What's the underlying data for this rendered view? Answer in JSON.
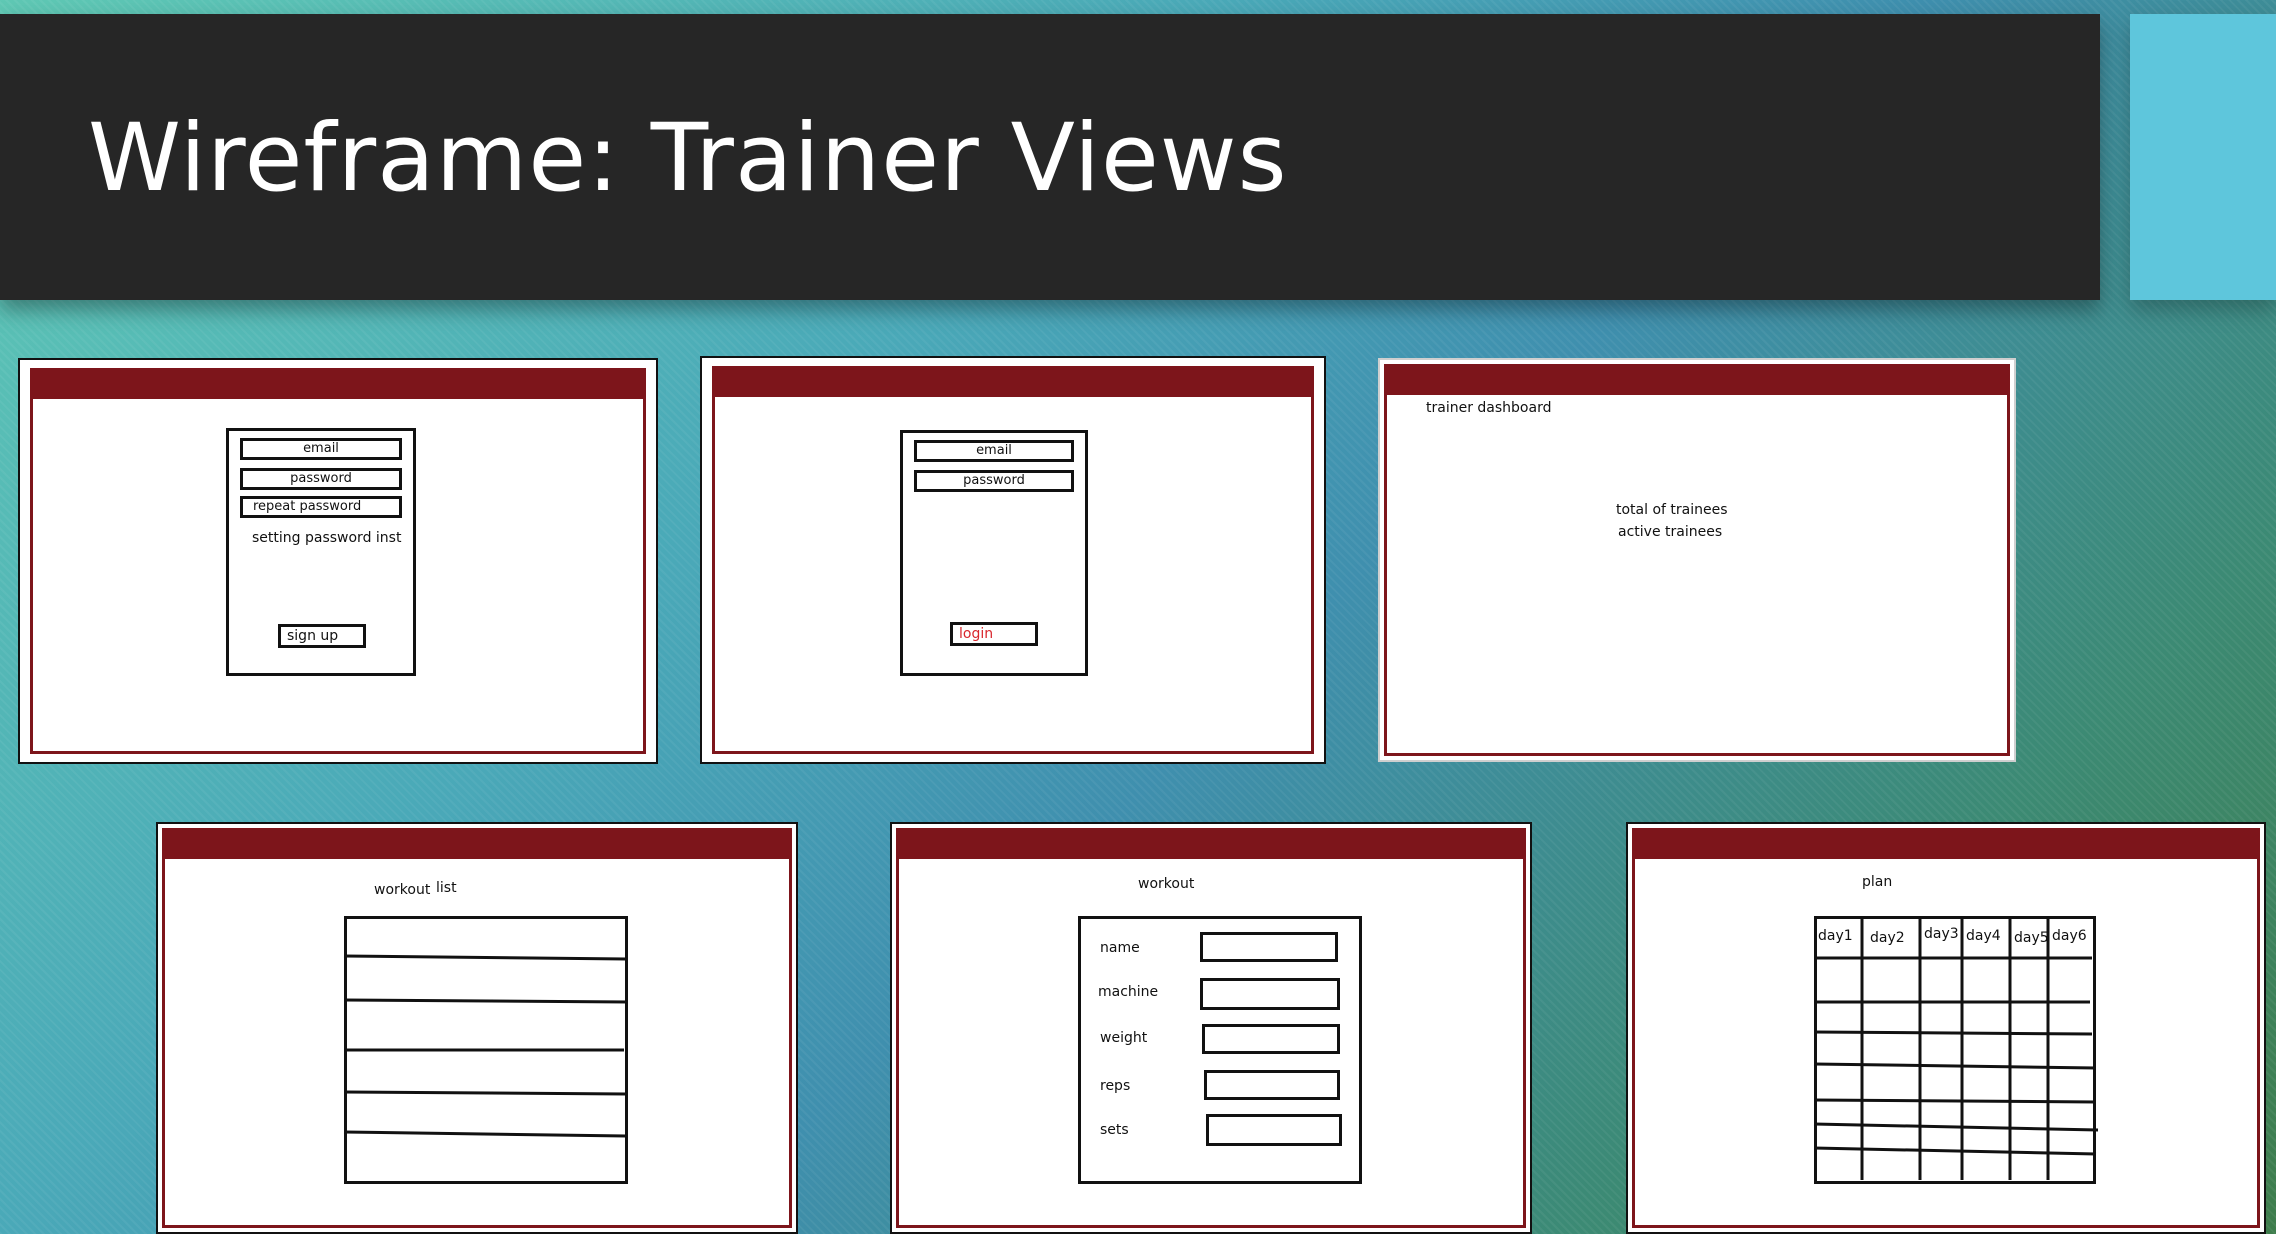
{
  "slide": {
    "title": "Wireframe: Trainer Views",
    "colors": {
      "title_bar": "#262626",
      "accent": "#5ec6dc",
      "panel_header": "#7d151b",
      "login_text": "#d8262c"
    }
  },
  "signup": {
    "fields": [
      "email",
      "password",
      "repeat password"
    ],
    "note": "setting password inst",
    "button": "sign up"
  },
  "login": {
    "fields": [
      "email",
      "password"
    ],
    "button": "login"
  },
  "dashboard": {
    "title": "trainer dashboard",
    "stats": [
      "total of trainees",
      "active trainees"
    ]
  },
  "workout_list": {
    "title_a": "workout",
    "title_b": "list"
  },
  "workout": {
    "title": "workout",
    "labels": [
      "name",
      "machine",
      "weight",
      "reps",
      "sets"
    ]
  },
  "plan": {
    "title": "plan",
    "days": [
      "day1",
      "day2",
      "day3",
      "day4",
      "day5",
      "day6"
    ]
  }
}
